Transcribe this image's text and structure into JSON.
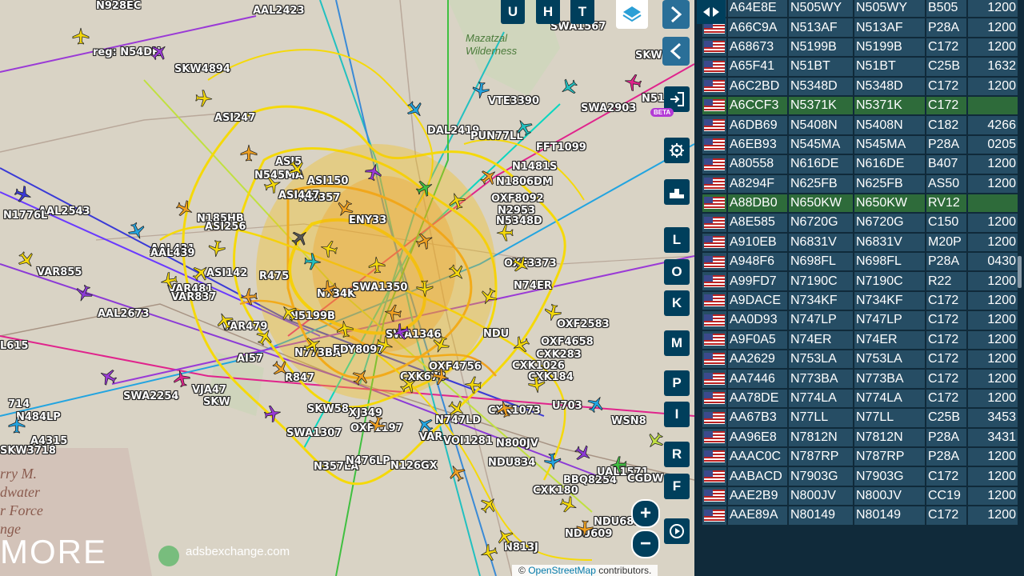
{
  "map": {
    "place_labels": [
      "Mazatzal",
      "Wilderness"
    ],
    "base_labels": [
      "rry M.",
      "dwater",
      "r Force",
      "nge"
    ],
    "branding": "MORE",
    "site": "adsbexchange.com",
    "attribution": {
      "prefix": "©",
      "link": "OpenStreetMap",
      "suffix": "contributors."
    },
    "aircraft_labels": [
      "N928EC",
      "AAL2423",
      "SWA1567",
      "SKW",
      "reg: N54DH",
      "SKW4894",
      "VTE3390",
      "SWA2903",
      "N51",
      "ASI247",
      "DAL2419",
      "PUN77LL",
      "FFT1099",
      "ASI5",
      "N545MA",
      "ASI150",
      "N1481S",
      "N1806DM",
      "OXF8092",
      "ASI357",
      "N2953",
      "ASI447",
      "ENY33",
      "N5348D",
      "AAL2543",
      "N1776L",
      "N185HB",
      "ASI256",
      "AAL431",
      "AAL439",
      "ASI142",
      "R475",
      "VAR855",
      "VAR481",
      "VAR837",
      "AAL2673",
      "VAR479",
      "N734K",
      "SWA1350",
      "N5199B",
      "OXF3373",
      "N74ER",
      "L615",
      "AI57",
      "R847",
      "N773BA",
      "FDY8097",
      "SWA1346",
      "NDU",
      "OXF2583",
      "OXF4658",
      "CXK283",
      "CXK1026",
      "CXK184",
      "CXK678",
      "OXF4756",
      "SWA2254",
      "VJA47",
      "714",
      "N484LP",
      "SKW",
      "SKW58",
      "XJ349",
      "OXF1197",
      "N747LD",
      "CXK1073",
      "WSN8",
      "U703",
      "VAR",
      "SWA1307",
      "N357LA",
      "N476LP",
      "N126GX",
      "VOI1281",
      "N800JV",
      "NDU834",
      "BBQ8254",
      "A4315",
      "SKW3718",
      "UAL1571",
      "CGDW",
      "CXK180",
      "NDU689",
      "NDU609",
      "N813J"
    ],
    "top_buttons": [
      "U",
      "H",
      "T"
    ],
    "beta": "BETA",
    "side_buttons": [
      "L",
      "O",
      "K",
      "M",
      "P",
      "I",
      "R",
      "F"
    ]
  },
  "colors": {
    "accent": "#003f5c",
    "row": "#264d64",
    "row_selected": "#2e6b3a",
    "track_yellow": "#f5d90a",
    "track_orange": "#f0a020"
  },
  "table": {
    "rows": [
      {
        "hex": "A64E8E",
        "reg": "N505WY",
        "call": "N505WY",
        "type": "B505",
        "sq": "1200"
      },
      {
        "hex": "A66C9A",
        "reg": "N513AF",
        "call": "N513AF",
        "type": "P28A",
        "sq": "1200"
      },
      {
        "hex": "A68673",
        "reg": "N5199B",
        "call": "N5199B",
        "type": "C172",
        "sq": "1200"
      },
      {
        "hex": "A65F41",
        "reg": "N51BT",
        "call": "N51BT",
        "type": "C25B",
        "sq": "1632"
      },
      {
        "hex": "A6C2BD",
        "reg": "N5348D",
        "call": "N5348D",
        "type": "C172",
        "sq": "1200"
      },
      {
        "hex": "A6CCF3",
        "reg": "N5371K",
        "call": "N5371K",
        "type": "C172",
        "sq": "",
        "sel": true
      },
      {
        "hex": "A6DB69",
        "reg": "N5408N",
        "call": "N5408N",
        "type": "C182",
        "sq": "4266"
      },
      {
        "hex": "A6EB93",
        "reg": "N545MA",
        "call": "N545MA",
        "type": "P28A",
        "sq": "0205"
      },
      {
        "hex": "A80558",
        "reg": "N616DE",
        "call": "N616DE",
        "type": "B407",
        "sq": "1200"
      },
      {
        "hex": "A8294F",
        "reg": "N625FB",
        "call": "N625FB",
        "type": "AS50",
        "sq": "1200"
      },
      {
        "hex": "A88DB0",
        "reg": "N650KW",
        "call": "N650KW",
        "type": "RV12",
        "sq": "",
        "sel": true
      },
      {
        "hex": "A8E585",
        "reg": "N6720G",
        "call": "N6720G",
        "type": "C150",
        "sq": "1200"
      },
      {
        "hex": "A910EB",
        "reg": "N6831V",
        "call": "N6831V",
        "type": "M20P",
        "sq": "1200"
      },
      {
        "hex": "A948F6",
        "reg": "N698FL",
        "call": "N698FL",
        "type": "P28A",
        "sq": "0430"
      },
      {
        "hex": "A99FD7",
        "reg": "N7190C",
        "call": "N7190C",
        "type": "R22",
        "sq": "1200"
      },
      {
        "hex": "A9DACE",
        "reg": "N734KF",
        "call": "N734KF",
        "type": "C172",
        "sq": "1200"
      },
      {
        "hex": "AA0D93",
        "reg": "N747LP",
        "call": "N747LP",
        "type": "C172",
        "sq": "1200"
      },
      {
        "hex": "A9F0A5",
        "reg": "N74ER",
        "call": "N74ER",
        "type": "C172",
        "sq": "1200"
      },
      {
        "hex": "AA2629",
        "reg": "N753LA",
        "call": "N753LA",
        "type": "C172",
        "sq": "1200"
      },
      {
        "hex": "AA7446",
        "reg": "N773BA",
        "call": "N773BA",
        "type": "C172",
        "sq": "1200"
      },
      {
        "hex": "AA78DE",
        "reg": "N774LA",
        "call": "N774LA",
        "type": "C172",
        "sq": "1200"
      },
      {
        "hex": "AA67B3",
        "reg": "N77LL",
        "call": "N77LL",
        "type": "C25B",
        "sq": "3453"
      },
      {
        "hex": "AA96E8",
        "reg": "N7812N",
        "call": "N7812N",
        "type": "P28A",
        "sq": "3431"
      },
      {
        "hex": "AAAC0C",
        "reg": "N787RP",
        "call": "N787RP",
        "type": "P28A",
        "sq": "1200"
      },
      {
        "hex": "AABACD",
        "reg": "N7903G",
        "call": "N7903G",
        "type": "C172",
        "sq": "1200"
      },
      {
        "hex": "AAE2B9",
        "reg": "N800JV",
        "call": "N800JV",
        "type": "CC19",
        "sq": "1200"
      },
      {
        "hex": "AAE89A",
        "reg": "N80149",
        "call": "N80149",
        "type": "C172",
        "sq": "1200"
      }
    ]
  }
}
